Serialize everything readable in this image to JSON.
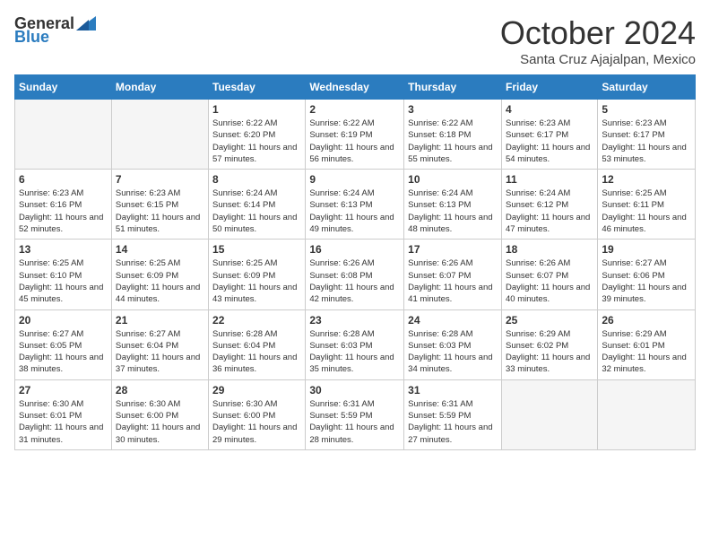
{
  "logo": {
    "general": "General",
    "blue": "Blue"
  },
  "title": "October 2024",
  "location": "Santa Cruz Ajajalpan, Mexico",
  "days_of_week": [
    "Sunday",
    "Monday",
    "Tuesday",
    "Wednesday",
    "Thursday",
    "Friday",
    "Saturday"
  ],
  "weeks": [
    [
      {
        "day": "",
        "empty": true
      },
      {
        "day": "",
        "empty": true
      },
      {
        "day": "1",
        "sunrise": "Sunrise: 6:22 AM",
        "sunset": "Sunset: 6:20 PM",
        "daylight": "Daylight: 11 hours and 57 minutes."
      },
      {
        "day": "2",
        "sunrise": "Sunrise: 6:22 AM",
        "sunset": "Sunset: 6:19 PM",
        "daylight": "Daylight: 11 hours and 56 minutes."
      },
      {
        "day": "3",
        "sunrise": "Sunrise: 6:22 AM",
        "sunset": "Sunset: 6:18 PM",
        "daylight": "Daylight: 11 hours and 55 minutes."
      },
      {
        "day": "4",
        "sunrise": "Sunrise: 6:23 AM",
        "sunset": "Sunset: 6:17 PM",
        "daylight": "Daylight: 11 hours and 54 minutes."
      },
      {
        "day": "5",
        "sunrise": "Sunrise: 6:23 AM",
        "sunset": "Sunset: 6:17 PM",
        "daylight": "Daylight: 11 hours and 53 minutes."
      }
    ],
    [
      {
        "day": "6",
        "sunrise": "Sunrise: 6:23 AM",
        "sunset": "Sunset: 6:16 PM",
        "daylight": "Daylight: 11 hours and 52 minutes."
      },
      {
        "day": "7",
        "sunrise": "Sunrise: 6:23 AM",
        "sunset": "Sunset: 6:15 PM",
        "daylight": "Daylight: 11 hours and 51 minutes."
      },
      {
        "day": "8",
        "sunrise": "Sunrise: 6:24 AM",
        "sunset": "Sunset: 6:14 PM",
        "daylight": "Daylight: 11 hours and 50 minutes."
      },
      {
        "day": "9",
        "sunrise": "Sunrise: 6:24 AM",
        "sunset": "Sunset: 6:13 PM",
        "daylight": "Daylight: 11 hours and 49 minutes."
      },
      {
        "day": "10",
        "sunrise": "Sunrise: 6:24 AM",
        "sunset": "Sunset: 6:13 PM",
        "daylight": "Daylight: 11 hours and 48 minutes."
      },
      {
        "day": "11",
        "sunrise": "Sunrise: 6:24 AM",
        "sunset": "Sunset: 6:12 PM",
        "daylight": "Daylight: 11 hours and 47 minutes."
      },
      {
        "day": "12",
        "sunrise": "Sunrise: 6:25 AM",
        "sunset": "Sunset: 6:11 PM",
        "daylight": "Daylight: 11 hours and 46 minutes."
      }
    ],
    [
      {
        "day": "13",
        "sunrise": "Sunrise: 6:25 AM",
        "sunset": "Sunset: 6:10 PM",
        "daylight": "Daylight: 11 hours and 45 minutes."
      },
      {
        "day": "14",
        "sunrise": "Sunrise: 6:25 AM",
        "sunset": "Sunset: 6:09 PM",
        "daylight": "Daylight: 11 hours and 44 minutes."
      },
      {
        "day": "15",
        "sunrise": "Sunrise: 6:25 AM",
        "sunset": "Sunset: 6:09 PM",
        "daylight": "Daylight: 11 hours and 43 minutes."
      },
      {
        "day": "16",
        "sunrise": "Sunrise: 6:26 AM",
        "sunset": "Sunset: 6:08 PM",
        "daylight": "Daylight: 11 hours and 42 minutes."
      },
      {
        "day": "17",
        "sunrise": "Sunrise: 6:26 AM",
        "sunset": "Sunset: 6:07 PM",
        "daylight": "Daylight: 11 hours and 41 minutes."
      },
      {
        "day": "18",
        "sunrise": "Sunrise: 6:26 AM",
        "sunset": "Sunset: 6:07 PM",
        "daylight": "Daylight: 11 hours and 40 minutes."
      },
      {
        "day": "19",
        "sunrise": "Sunrise: 6:27 AM",
        "sunset": "Sunset: 6:06 PM",
        "daylight": "Daylight: 11 hours and 39 minutes."
      }
    ],
    [
      {
        "day": "20",
        "sunrise": "Sunrise: 6:27 AM",
        "sunset": "Sunset: 6:05 PM",
        "daylight": "Daylight: 11 hours and 38 minutes."
      },
      {
        "day": "21",
        "sunrise": "Sunrise: 6:27 AM",
        "sunset": "Sunset: 6:04 PM",
        "daylight": "Daylight: 11 hours and 37 minutes."
      },
      {
        "day": "22",
        "sunrise": "Sunrise: 6:28 AM",
        "sunset": "Sunset: 6:04 PM",
        "daylight": "Daylight: 11 hours and 36 minutes."
      },
      {
        "day": "23",
        "sunrise": "Sunrise: 6:28 AM",
        "sunset": "Sunset: 6:03 PM",
        "daylight": "Daylight: 11 hours and 35 minutes."
      },
      {
        "day": "24",
        "sunrise": "Sunrise: 6:28 AM",
        "sunset": "Sunset: 6:03 PM",
        "daylight": "Daylight: 11 hours and 34 minutes."
      },
      {
        "day": "25",
        "sunrise": "Sunrise: 6:29 AM",
        "sunset": "Sunset: 6:02 PM",
        "daylight": "Daylight: 11 hours and 33 minutes."
      },
      {
        "day": "26",
        "sunrise": "Sunrise: 6:29 AM",
        "sunset": "Sunset: 6:01 PM",
        "daylight": "Daylight: 11 hours and 32 minutes."
      }
    ],
    [
      {
        "day": "27",
        "sunrise": "Sunrise: 6:30 AM",
        "sunset": "Sunset: 6:01 PM",
        "daylight": "Daylight: 11 hours and 31 minutes."
      },
      {
        "day": "28",
        "sunrise": "Sunrise: 6:30 AM",
        "sunset": "Sunset: 6:00 PM",
        "daylight": "Daylight: 11 hours and 30 minutes."
      },
      {
        "day": "29",
        "sunrise": "Sunrise: 6:30 AM",
        "sunset": "Sunset: 6:00 PM",
        "daylight": "Daylight: 11 hours and 29 minutes."
      },
      {
        "day": "30",
        "sunrise": "Sunrise: 6:31 AM",
        "sunset": "Sunset: 5:59 PM",
        "daylight": "Daylight: 11 hours and 28 minutes."
      },
      {
        "day": "31",
        "sunrise": "Sunrise: 6:31 AM",
        "sunset": "Sunset: 5:59 PM",
        "daylight": "Daylight: 11 hours and 27 minutes."
      },
      {
        "day": "",
        "empty": true
      },
      {
        "day": "",
        "empty": true
      }
    ]
  ]
}
